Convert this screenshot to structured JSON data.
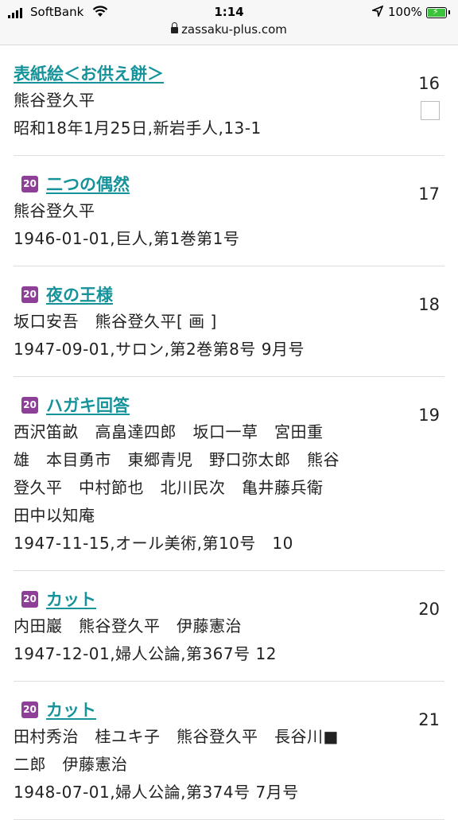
{
  "status_bar": {
    "carrier": "SoftBank",
    "time": "1:14",
    "battery": "100%",
    "url": "zassaku-plus.com"
  },
  "badge_text": "20",
  "entries": [
    {
      "title": "表紙絵＜お供え餅＞",
      "num": "16",
      "badge": false,
      "checkbox": true,
      "lines": [
        "熊谷登久平",
        "昭和18年1月25日,新岩手人,13-1"
      ]
    },
    {
      "title": "二つの偶然",
      "num": "17",
      "badge": true,
      "checkbox": false,
      "lines": [
        "熊谷登久平",
        "1946-01-01,巨人,第1巻第1号"
      ]
    },
    {
      "title": "夜の王様",
      "num": "18",
      "badge": true,
      "checkbox": false,
      "lines": [
        "坂口安吾　熊谷登久平[ 画 ]",
        "1947-09-01,サロン,第2巻第8号 9月号"
      ]
    },
    {
      "title": "ハガキ回答",
      "num": "19",
      "badge": true,
      "checkbox": false,
      "lines": [
        "西沢笛畝　高畠達四郎　坂口一草　宮田重",
        "雄　本目勇市　東郷青児　野口弥太郎　熊谷",
        "登久平　中村節也　北川民次　亀井藤兵衛",
        "田中以知庵",
        "1947-11-15,オール美術,第10号　10"
      ]
    },
    {
      "title": "カット",
      "num": "20",
      "badge": true,
      "checkbox": false,
      "lines": [
        "内田巖　熊谷登久平　伊藤憲治",
        "1947-12-01,婦人公論,第367号 12"
      ]
    },
    {
      "title": "カット",
      "num": "21",
      "badge": true,
      "checkbox": false,
      "lines": [
        "田村秀治　桂ユキ子　熊谷登久平　長谷川■",
        "二郎　伊藤憲治",
        "1948-07-01,婦人公論,第374号 7月号"
      ]
    }
  ]
}
